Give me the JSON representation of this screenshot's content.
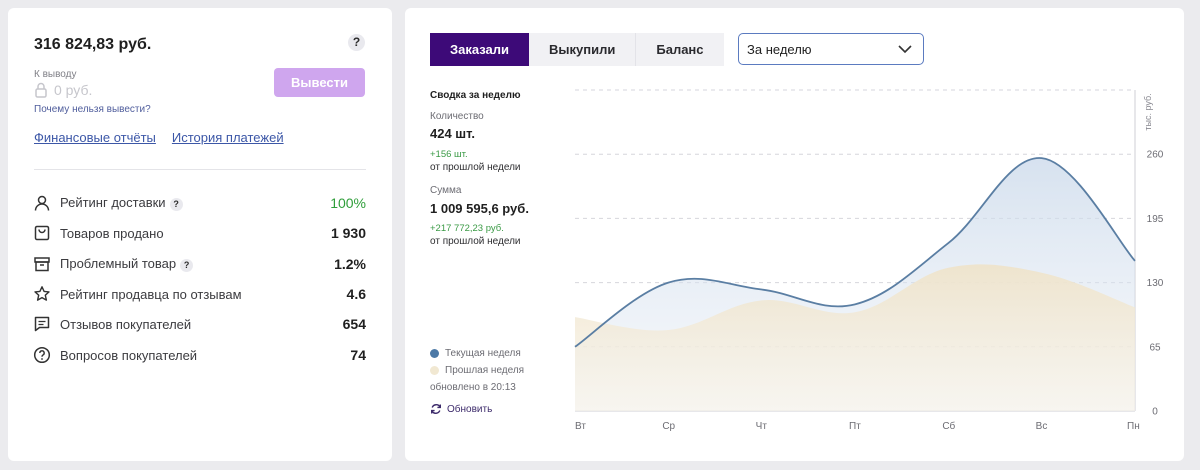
{
  "balance": {
    "amount": "316 824,83 руб.",
    "help": "?"
  },
  "withdraw": {
    "label": "К выводу",
    "amount": "0 руб.",
    "why_link": "Почему нельзя вывести?",
    "button": "Вывести"
  },
  "links": {
    "reports": "Финансовые отчёты",
    "history": "История платежей"
  },
  "stats": [
    {
      "label": "Рейтинг доставки",
      "value": "100%",
      "icon": "person-icon",
      "help": "?"
    },
    {
      "label": "Товаров продано",
      "value": "1 930",
      "icon": "bag-icon"
    },
    {
      "label": "Проблемный товар",
      "value": "1.2%",
      "icon": "box-icon",
      "help": "?"
    },
    {
      "label": "Рейтинг продавца по отзывам",
      "value": "4.6",
      "icon": "star-icon"
    },
    {
      "label": "Отзывов покупателей",
      "value": "654",
      "icon": "comment-icon"
    },
    {
      "label": "Вопросов покупателей",
      "value": "74",
      "icon": "question-icon"
    }
  ],
  "colors": {
    "accent": "#3d0a78",
    "button": "#cfa6ee",
    "green": "#2f9e3a",
    "current": "#5a7ea3",
    "previous": "#f0e6d2"
  },
  "tabs": [
    {
      "label": "Заказали",
      "active": true
    },
    {
      "label": "Выкупили"
    },
    {
      "label": "Баланс"
    }
  ],
  "period_select": "За неделю",
  "summary": {
    "title": "Сводка за неделю",
    "qty_label": "Количество",
    "qty_value": "424 шт.",
    "qty_delta": "+156 шт.",
    "qty_delta_sub": "от прошлой недели",
    "sum_label": "Сумма",
    "sum_value": "1 009 595,6 руб.",
    "sum_delta": "+217 772,23 руб.",
    "sum_delta_sub": "от прошлой недели"
  },
  "legend": {
    "current": "Текущая неделя",
    "previous": "Прошлая неделя",
    "updated": "обновлено в 20:13"
  },
  "refresh": "Обновить",
  "chart_data": {
    "type": "area",
    "categories": [
      "Вт",
      "Ср",
      "Чт",
      "Пт",
      "Сб",
      "Вс",
      "Пн"
    ],
    "series": [
      {
        "name": "Текущая неделя",
        "values": [
          65,
          130,
          123,
          108,
          170,
          256,
          152
        ]
      },
      {
        "name": "Прошлая неделя",
        "values": [
          95,
          82,
          112,
          100,
          145,
          140,
          105
        ]
      }
    ],
    "ylabel": "тыс. руб.",
    "yticks": [
      0,
      65,
      130,
      195,
      260
    ],
    "ylim": [
      0,
      325
    ],
    "grid": true,
    "legend": "bottom-left"
  }
}
